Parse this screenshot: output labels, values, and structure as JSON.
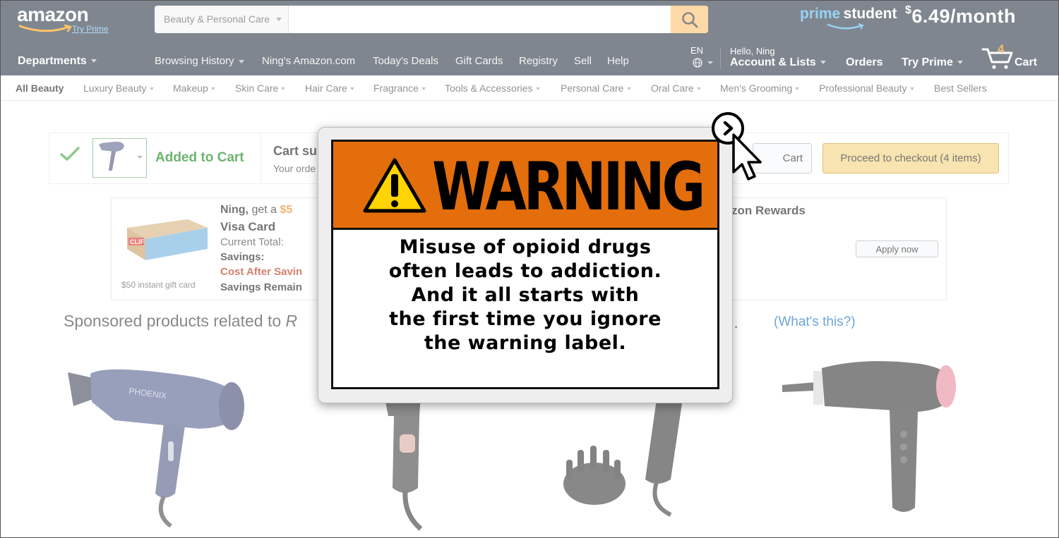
{
  "header": {
    "logo_text": "amazon",
    "logo_try_prime": "Try Prime",
    "search": {
      "department": "Beauty & Personal Care",
      "value": "",
      "placeholder": ""
    },
    "promo": {
      "prime": "prime",
      "student": "student",
      "currency": "$",
      "price": "6.49/month"
    }
  },
  "nav": {
    "departments": "Departments",
    "links": [
      "Browsing History",
      "Ning's Amazon.com",
      "Today's Deals",
      "Gift Cards",
      "Registry",
      "Sell",
      "Help"
    ],
    "language": "EN",
    "hello": "Hello, Ning",
    "account": "Account & Lists",
    "orders": "Orders",
    "try_prime": "Try Prime",
    "cart_count": "4",
    "cart_label": "Cart"
  },
  "subnav": {
    "items": [
      "All Beauty",
      "Luxury Beauty",
      "Makeup",
      "Skin Care",
      "Hair Care",
      "Fragrance",
      "Tools & Accessories",
      "Personal Care",
      "Oral Care",
      "Men's Grooming",
      "Professional Beauty",
      "Best Sellers"
    ]
  },
  "cart": {
    "added": "Added to Cart",
    "subtotal_partial": "Cart su",
    "your_order_partial": "Your orde",
    "cart_button_partial": "Cart",
    "checkout": "Proceed to checkout (4 items)"
  },
  "promo_card": {
    "name": "Ning,",
    "get_a": " get a ",
    "amount_partial": "$5",
    "visa": "Visa Card",
    "current_total": "Current Total:",
    "savings": "Savings:",
    "cost_after": "Cost After Savin",
    "savings_remain": "Savings Remain",
    "gift_caption": "$50 instant gift card",
    "clif_label": "CLIF",
    "rewards_partial": "zon Rewards",
    "apply": "Apply now"
  },
  "sponsored": {
    "left": "Sponsored products related to ",
    "left_italic": "R",
    "right_italic": "er,...",
    "whats_this": "(What's this?)"
  },
  "products": {
    "brand_label": "PHOENIX"
  },
  "warning": {
    "title": "WARNING",
    "lines": [
      "Misuse of opioid drugs",
      "often leads to addiction.",
      "And it all starts with",
      "the first time you ignore",
      "the warning label."
    ]
  },
  "colors": {
    "header_bg": "#232f3e",
    "search_button": "#febd69",
    "warning_orange": "#e36e0b",
    "added_green": "#067d06",
    "checkout_yellow": "#f3d078"
  },
  "icons": [
    "search-icon",
    "globe-icon",
    "cart-icon",
    "check-icon",
    "warning-triangle-icon",
    "close-chevron-icon",
    "mouse-cursor-icon"
  ]
}
